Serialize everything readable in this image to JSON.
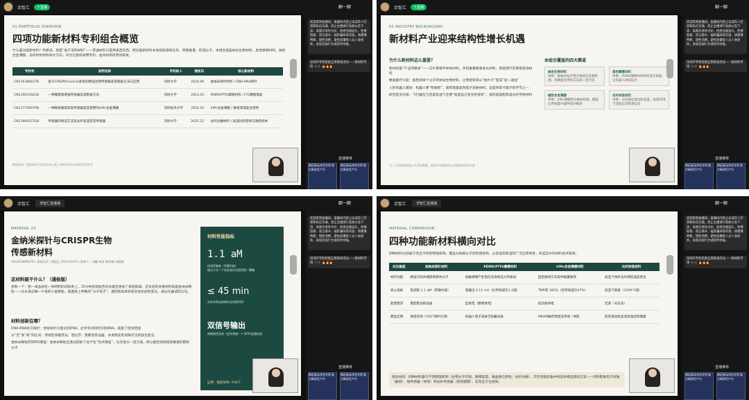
{
  "host_name": "余智汇",
  "live_badge": "十直播",
  "tab_label": "求智汇直播播",
  "right_title": "聊一聊",
  "chat1": "欢迎来到直播间，直播间内禁止未成年人打赏和私信沟通，禁止主播进行低俗以及下流、高频次诱导讨论，拒绝违规送礼、色情低俗、谣言惑众、抽奖骗局等内容，请谨慎判断，理性消费，避免因遭受人员人身损失，发现违规行为请及时举报。",
  "chat2": "深圳市专利检索应用系统活动——新材料专场（一）🔥🔥🔥",
  "recommend_label": "直播推荐",
  "thumb_text": "两区联动共话专利 助力新质生产力",
  "q1": {
    "kicker": "01 PORTFOLIO OVERVIEW",
    "title": "四项功能新材料专利组合概览",
    "intro": "什么是功能新材料？简单说，就是“能干活的材料”——普通材料只是用来造东西，而功能新材料本身就能感知信号、转换能量、检测分子。本组合涵盖纳米生物材料、柔性摩擦材料、磁性合金薄膜、光纤封装材料四大方向，均为已授权发明专利，由深圳高校原创研发。",
    "headers": [
      "专利号",
      "发明名称",
      "专利权人",
      "授权日",
      "核心新材料"
    ],
    "rows": [
      [
        "CN116386647B",
        "基于CRISPR/Cas13a系统的精准生物传感器及其制备方法与应用",
        "深圳大学",
        "2024.09",
        "金纳米探针材料 / DNA-RNA探针"
      ],
      [
        "CN115014561B",
        "一种摩擦电增强传感器及其制备方法",
        "深圳大学",
        "2023.10",
        "PDMS/PTFE摩擦材料 / ITO薄膜电极"
      ],
      [
        "CN117750070B",
        "一种微波磁电调谐传感器及其使用的IrMn合金薄膜",
        "深圳技术大学",
        "2024.10",
        "IrMn合金薄膜 / 磁电调谐复合结构"
      ],
      [
        "CN119643731B",
        "传感器的制造方法及光纤高温定常传感器",
        "深圳大学",
        "2025.12",
        "光纤光栅材料 / 高温封装结构与微结构体"
      ]
    ],
    "footer": "数据来源：国家知识产权局专利公报 | 所有专利均为授权发明专利"
  },
  "q2": {
    "kicker": "02 INDUSTRY BACKGROUND",
    "title": "新材料产业迎来结构性增长机遇",
    "left_heading": "为什么新材料这么重要？",
    "bullets": [
      "新材料是“产业的粮食”——芯片要靠半导体材料，手机屏幕要靠发光材料，新能源汽车要靠电池材料",
      "精准医疗兴起：能检测单个分子的纳米生物材料，让癌症早筛从“拍片子”变成“验一滴血”",
      "人形机器人爆发：机器人要“有触觉”，靠的就是柔性电子皮肤材料，这是目前卡脖子的环节之一",
      "航空航天升级：飞行器在几百度高温下还要“知道自己有没有变形”，靠的就是耐高温光纤传感材料"
    ],
    "right_heading": "本组合覆盖的四大赛道",
    "cards": [
      {
        "name": "纳米生物材料",
        "desc": "举例：金纳米粒子用于癌症标志物检测，灵敏度比传统方法高一百万倍"
      },
      {
        "name": "柔性摩擦材料",
        "desc": "举例：PDMS摩擦材料制作电子皮肤，让机器人感知压力"
      },
      {
        "name": "磁性合金薄膜",
        "desc": "举例：IrMn薄膜用于磁场检测，精度比传统霍尔器件提升数倍"
      },
      {
        "name": "光纤封装材料",
        "desc": "举例：光纤感应发动机温度，高温环境下还能正常检测信号"
      }
    ],
    "footer": "注：行业趋势依据公开资料整理，具体市场规模请以权威机构发布为准"
  },
  "q3": {
    "kicker": "MATERIAL 01",
    "title": "金纳米探针与CRISPR生物传感新材料",
    "meta": "CN116386647B | 深圳大学 | 授权日 2024.09.03 | 发明人：刘耀 朱炎 杨欣瑞 刘佩熠",
    "q_heading": "这材料能干什么？（通俗版）",
    "q_text": "想象一下：把一滴血滴在一张特制的试纸条上，15分钟后就能告诉你是否感染了新冠病毒，这背后的关键材料就是金纳米颗粒——比头发丝细一千倍的小金颗粒，表面接上特殊的“分子钩子”，遇到病毒目标就会发生颜色变化，通过仪器读取信号。",
    "innov_heading": "材料创新在哪？",
    "innov": [
      "DNA-RNA杂交探针：传统探针只能识别DNA，此专利可同时识别RNA，拓宽了检测范围",
      "从“无”到“有”的信号：传统检测靠荧光、电化学，需要昂贵设备；本发明实现肉眼可见的颜色变化",
      "金纳米颗粒的SERS增强：金纳米颗粒在激光照射下会产生“热点增强”，信号放大一百万倍，所以能检测到极其微量的靶标分子"
    ],
    "panel_title": "材料性能指标",
    "m1_value": "1.1 aM",
    "m1_desc": "检测灵敏度（阿摩尔级）\n相当于在一个标准游泳池里找到一颗糖",
    "m2_value": "≤ 45 min",
    "m2_desc": "从样本到出结果的全流程时间",
    "m3_value": "双信号输出",
    "m3_desc": "肉眼颜色判读（定性筛查）+ SERS定量检测",
    "panel_footer": "应用：癌症早筛 / POCT"
  },
  "q4": {
    "kicker": "MATERIAL COMPARISON",
    "title": "四种功能新材料横向对比",
    "intro": "四种材料分别基于完全不同的物理机制，覆盖从纳观分子到宏观结构、从常温到高温的广泛应用场景，形成互补的材料技术矩阵。",
    "headers": [
      "对比维度",
      "金纳米探针材料",
      "PDMS/PTFE摩擦材料",
      "IrMn合金薄膜材料",
      "光纤封装材料"
    ],
    "rows": [
      [
        "材料功能",
        "精准识别并捕获病原体分子",
        "接触摩擦产生电信号感知压力和振动",
        "固定磁场方向提供偏置磁场",
        "高温下保护光纤感知温度变化"
      ],
      [
        "核心指标",
        "检测限 1.1 aM（阿摩尔级）",
        "电输出 0.11 mA（比传统提升1.4倍）",
        "TMR率 182%（较传统提升47%）",
        "高温下耐受（1200°C级）"
      ],
      [
        "能量需求",
        "需配套读取设备",
        "自发电（摩擦发电）",
        "低功耗供电",
        "无源（光信号）"
      ],
      [
        "典型应用",
        "癌症早筛 / POCT即时诊断",
        "机器人电子皮肤可穿戴设备",
        "MRAM磁存储电流传感 / 导航",
        "航空发动机监测高温结构健康"
      ]
    ],
    "summary": "组合协同：四种材料基于不同物理机制（生物分子识别、摩擦起电、磁晶各向异性、光纤光栅），可在智能装备中构成多模态感知方案——同时配备电子皮肤（触觉）、磁传感器（导航）和光纤传感器（结构健康），实现全方位感知。"
  },
  "stats": {
    "likes": "15",
    "viewers": "5.2万"
  }
}
